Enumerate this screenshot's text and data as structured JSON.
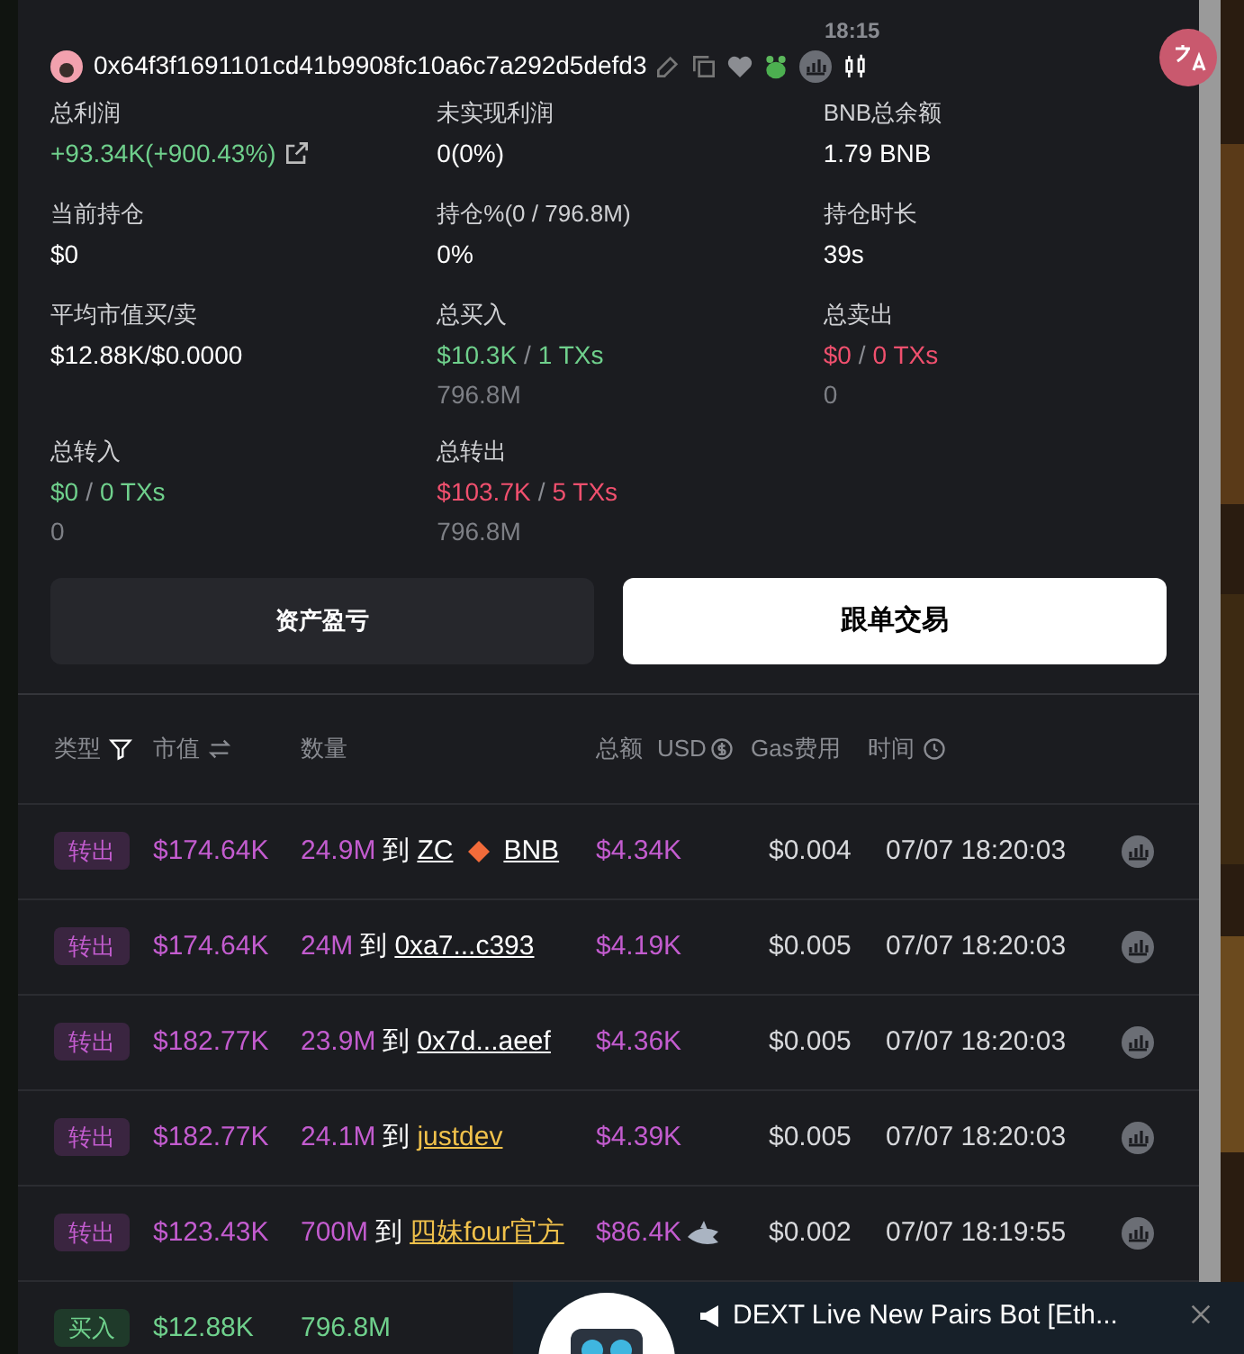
{
  "top": {
    "time": "18:15"
  },
  "wallet": {
    "address": "0x64f3f1691101cd41b9908fc10a6c7a292d5defd3"
  },
  "stats": [
    {
      "label": "总利润",
      "value": "+93.34K(+900.43%)",
      "color": "#6fd08c",
      "link": true
    },
    {
      "label": "未实现利润",
      "value": "0(0%)",
      "color": "#ffffff"
    },
    {
      "label": "BNB总余额",
      "value": "1.79 BNB",
      "color": "#ffffff"
    },
    {
      "label": "当前持仓",
      "value": "$0",
      "color": "#ffffff"
    },
    {
      "label": "持仓%(0 / 796.8M)",
      "value": "0%",
      "color": "#ffffff"
    },
    {
      "label": "持仓时长",
      "value": "39s",
      "color": "#ffffff"
    },
    {
      "label": "平均市值买/卖",
      "value": "$12.88K/$0.0000",
      "color": "#ffffff"
    },
    {
      "label": "总买入",
      "value": "$10.3K",
      "separator": "/",
      "txs": "1 TXs",
      "sub": "796.8M",
      "color": "#6fd08c"
    },
    {
      "label": "总卖出",
      "value": "$0",
      "separator": "/",
      "txs": "0 TXs",
      "sub": "0",
      "color": "#f0506e"
    },
    {
      "label": "总转入",
      "value": "$0",
      "separator": "/",
      "txs": "0 TXs",
      "sub": "0",
      "color": "#6fd08c"
    },
    {
      "label": "总转出",
      "value": "$103.7K",
      "separator": "/",
      "txs": "5 TXs",
      "sub": "796.8M",
      "color": "#f0506e"
    }
  ],
  "buttons": [
    {
      "label": "资产盈亏",
      "selected": false
    },
    {
      "label": "跟单交易",
      "selected": true
    }
  ],
  "table": {
    "columns": [
      "类型",
      "市值",
      "数量",
      "总额",
      "USD",
      "Gas费用",
      "时间"
    ],
    "rows": [
      {
        "type": "转出",
        "kind": "out",
        "market_cap": "$174.64K",
        "quantity": "24.9M",
        "to": "到",
        "recipient": {
          "text": "ZC",
          "suffix": "BNB",
          "color": "#ffffff"
        },
        "total": "$4.34K",
        "gas": "$0.004",
        "time": "07/07 18:20:03"
      },
      {
        "type": "转出",
        "kind": "out",
        "market_cap": "$174.64K",
        "quantity": "24M",
        "to": "到",
        "recipient": {
          "text": "0xa7...c393",
          "color": "#ffffff"
        },
        "total": "$4.19K",
        "gas": "$0.005",
        "time": "07/07 18:20:03"
      },
      {
        "type": "转出",
        "kind": "out",
        "market_cap": "$182.77K",
        "quantity": "23.9M",
        "to": "到",
        "recipient": {
          "text": "0x7d...aeef",
          "color": "#ffffff"
        },
        "total": "$4.36K",
        "gas": "$0.005",
        "time": "07/07 18:20:03"
      },
      {
        "type": "转出",
        "kind": "out",
        "market_cap": "$182.77K",
        "quantity": "24.1M",
        "to": "到",
        "recipient": {
          "text": "justdev",
          "color": "#f0c14b"
        },
        "total": "$4.39K",
        "gas": "$0.005",
        "time": "07/07 18:20:03"
      },
      {
        "type": "转出",
        "kind": "out",
        "market_cap": "$123.43K",
        "quantity": "700M",
        "to": "到",
        "recipient": {
          "text": "四妹four官方",
          "color": "#f0c14b"
        },
        "total": "$86.4K",
        "whale": true,
        "gas": "$0.002",
        "time": "07/07 18:19:55"
      },
      {
        "type": "买入",
        "kind": "in",
        "market_cap": "$12.88K",
        "quantity": "796.8M"
      }
    ]
  },
  "notification": {
    "title": "DEXT Live New Pairs Bot [Eth..."
  }
}
